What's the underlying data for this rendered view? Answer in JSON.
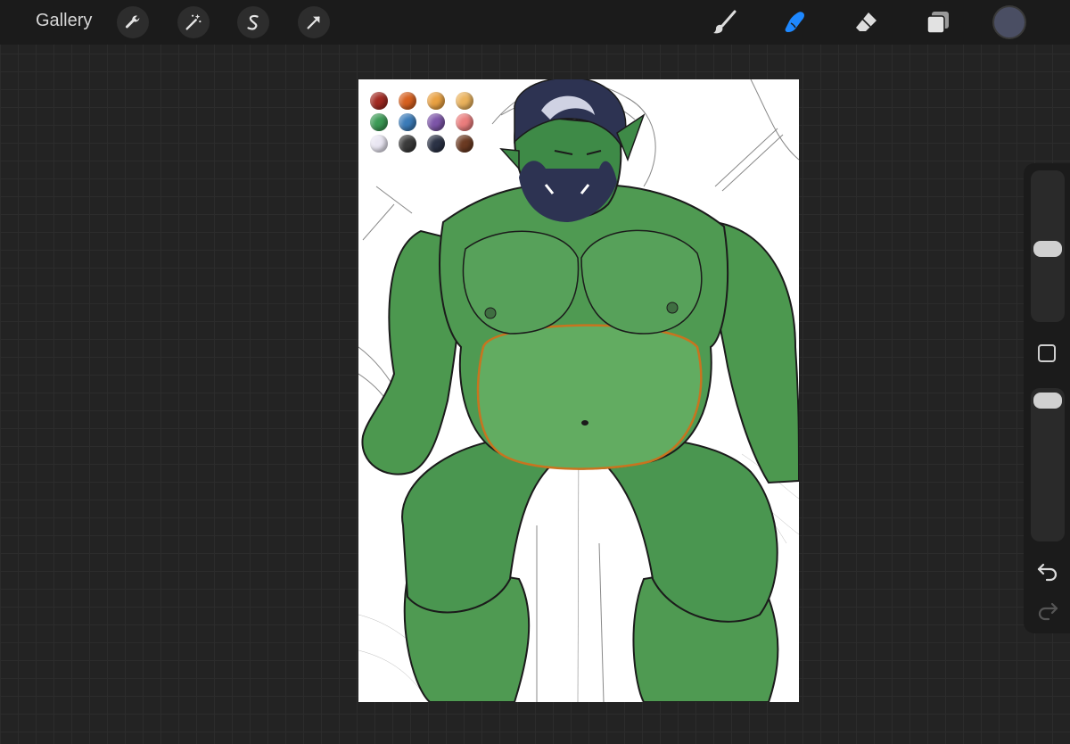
{
  "topbar": {
    "gallery_label": "Gallery",
    "left_tools": [
      "wrench-icon",
      "magic-wand-icon",
      "selection-icon",
      "transform-arrow-icon"
    ],
    "right_tools": [
      "brush-icon",
      "smudge-icon",
      "eraser-icon",
      "layers-icon"
    ],
    "active_tool": "smudge-icon",
    "active_color": "#4a4e63",
    "accent_color": "#1e88ff"
  },
  "sidebar": {
    "brush_size_level": 0.35,
    "opacity_level": 0.08,
    "buttons": [
      "modify-square-icon",
      "undo-icon",
      "redo-icon"
    ]
  },
  "canvas": {
    "palette_colors": [
      [
        "#a12a22",
        "#d6601f",
        "#e9a142",
        "#eab25c"
      ],
      [
        "#3b9a55",
        "#3b7bb8",
        "#7d55a8",
        "#ea7d7d"
      ],
      [
        "#e9e6f2",
        "#3a3a3a",
        "#2b3245",
        "#6b3a22"
      ]
    ],
    "skin_color": "#4f9a52",
    "hair_color": "#2d3352"
  }
}
